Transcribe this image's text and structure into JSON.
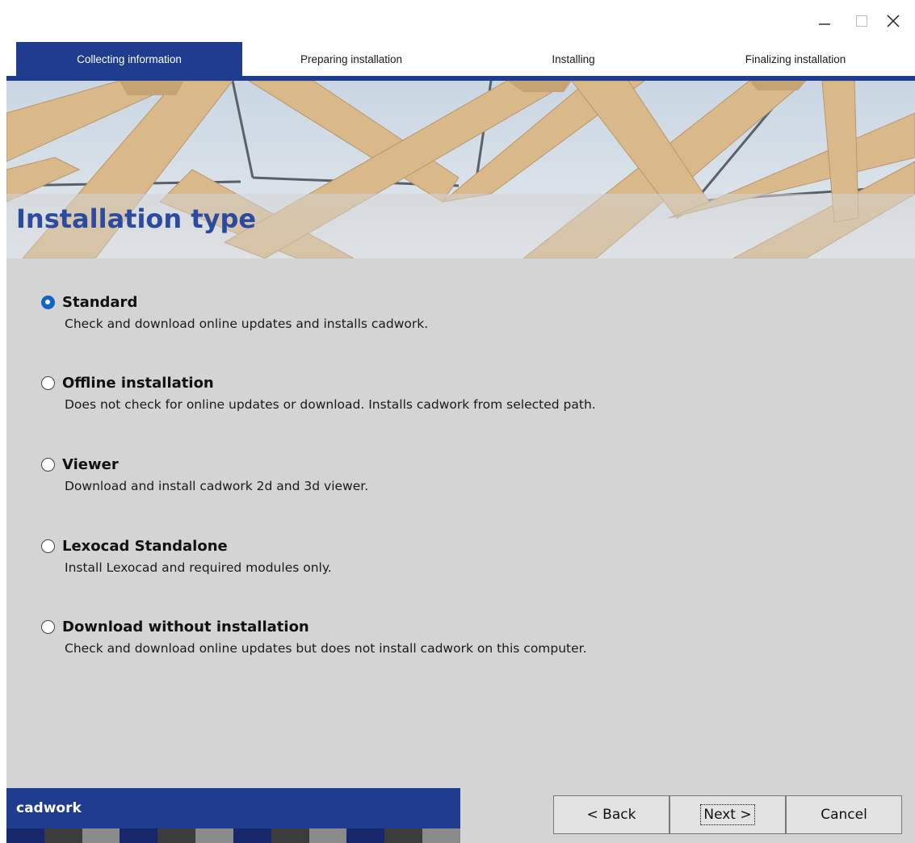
{
  "window": {
    "minimize_icon": "minimize-icon",
    "maximize_icon": "maximize-icon",
    "close_icon": "close-icon"
  },
  "steps": [
    {
      "label": "Collecting information",
      "active": true
    },
    {
      "label": "Preparing installation",
      "active": false
    },
    {
      "label": "Installing",
      "active": false
    },
    {
      "label": "Finalizing installation",
      "active": false
    }
  ],
  "banner": {
    "title": "Installation type"
  },
  "options": [
    {
      "label": "Standard",
      "description": "Check and download online updates and installs cadwork.",
      "selected": true
    },
    {
      "label": "Offline installation",
      "description": "Does not check for online updates or download. Installs cadwork from selected path.",
      "selected": false
    },
    {
      "label": "Viewer",
      "description": "Download and install cadwork 2d and 3d viewer.",
      "selected": false
    },
    {
      "label": "Lexocad Standalone",
      "description": "Install Lexocad and required modules only.",
      "selected": false
    },
    {
      "label": "Download without installation",
      "description": "Check and download online updates but does not install cadwork on this computer.",
      "selected": false
    }
  ],
  "footer": {
    "brand": "cadwork",
    "back_label": "< Back",
    "next_label": "Next >",
    "cancel_label": "Cancel"
  },
  "colors": {
    "accent": "#1f3c8e",
    "title": "#2b4aa0",
    "radio_selected": "#1463c7",
    "panel": "#d4d4d4"
  }
}
